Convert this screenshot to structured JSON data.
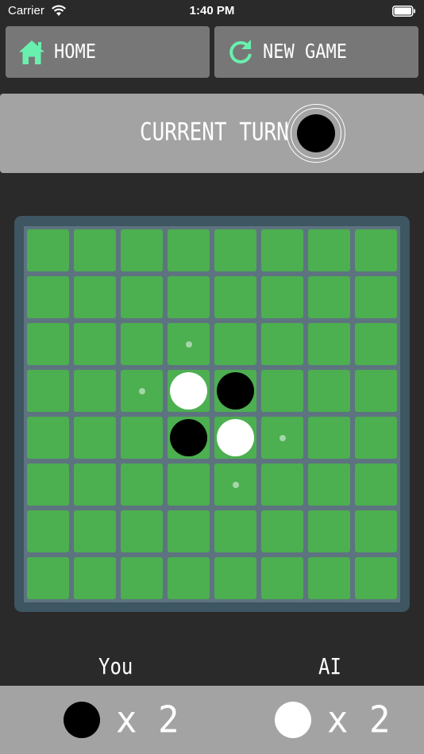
{
  "status_bar": {
    "carrier": "Carrier",
    "time": "1:40 PM"
  },
  "toolbar": {
    "home_label": "HOME",
    "new_game_label": "NEW GAME",
    "home_icon": "home-icon",
    "new_game_icon": "refresh-icon",
    "icon_color": "#69f0ae"
  },
  "turn": {
    "label": "CURRENT TURN",
    "current_player": "black"
  },
  "board": {
    "size": 8,
    "cells": [
      [
        "",
        "",
        "",
        "",
        "",
        "",
        "",
        ""
      ],
      [
        "",
        "",
        "",
        "",
        "",
        "",
        "",
        ""
      ],
      [
        "",
        "",
        "",
        "hint",
        "",
        "",
        "",
        ""
      ],
      [
        "",
        "",
        "hint",
        "white",
        "black",
        "",
        "",
        ""
      ],
      [
        "",
        "",
        "",
        "black",
        "white",
        "hint",
        "",
        ""
      ],
      [
        "",
        "",
        "",
        "",
        "hint",
        "",
        "",
        ""
      ],
      [
        "",
        "",
        "",
        "",
        "",
        "",
        "",
        ""
      ],
      [
        "",
        "",
        "",
        "",
        "",
        "",
        "",
        ""
      ]
    ],
    "colors": {
      "cell": "#4caf50",
      "grid": "#5e7380",
      "frame": "#3e5562",
      "hint": "#a5d6a7"
    }
  },
  "players": {
    "you": {
      "label": "You",
      "score_text": "x 2",
      "color": "black"
    },
    "ai": {
      "label": "AI",
      "score_text": "x 2",
      "color": "white"
    }
  }
}
